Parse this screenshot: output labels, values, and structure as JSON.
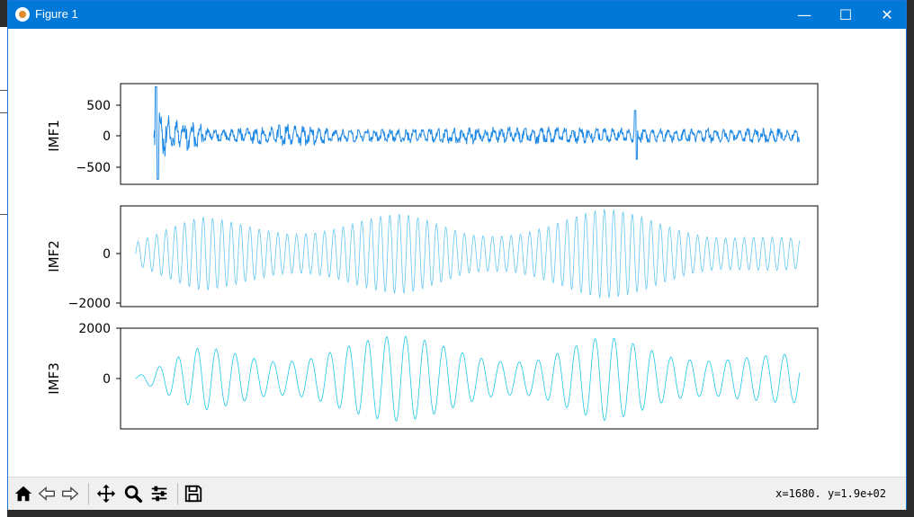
{
  "window": {
    "title": "Figure 1",
    "minimize_glyph": "—",
    "maximize_glyph": "☐",
    "close_glyph": "✕"
  },
  "toolbar": {
    "icons": [
      "home-icon",
      "back-icon",
      "forward-icon",
      "pan-icon",
      "zoom-icon",
      "configure-subplots-icon",
      "save-icon"
    ],
    "coords": "x=1680. y=1.9e+02"
  },
  "colors": {
    "titlebar": "#0078d7",
    "imf1": "#1e88e5",
    "imf2": "#64c8f0",
    "imf3": "#1ec8e6"
  },
  "chart_data": [
    {
      "type": "line",
      "ylabel": "IMF1",
      "yticks": [
        "500",
        "0",
        "−500"
      ],
      "ytick_values": [
        500,
        0,
        -500
      ],
      "ylim": [
        -780,
        830
      ],
      "xlim": [
        -5,
        225
      ],
      "x": [
        6,
        28,
        50,
        72,
        94,
        116,
        138,
        160,
        182,
        204,
        215
      ],
      "series": [
        {
          "values": [
            -680,
            60,
            250,
            80,
            120,
            160,
            150,
            110,
            100,
            130,
            100
          ]
        }
      ],
      "note_data": "envelope peaks: 780 at x≈7, 320 at x≈45, 300 at x≈130, 400 at x≈165"
    },
    {
      "type": "line",
      "ylabel": "IMF2",
      "yticks": [
        "0",
        "−2000"
      ],
      "ytick_values": [
        0,
        -2000
      ],
      "ylim": [
        -2100,
        1900
      ],
      "xlim": [
        -5,
        225
      ],
      "x": [
        0,
        22,
        44,
        66,
        88,
        110,
        132,
        154,
        176,
        198,
        220
      ],
      "series": [
        {
          "values": [
            600,
            -1500,
            1600,
            -1500,
            1600,
            -1200,
            1600,
            -1800,
            1500,
            -1200,
            -600
          ]
        }
      ]
    },
    {
      "type": "line",
      "ylabel": "IMF3",
      "yticks": [
        "2000",
        "0"
      ],
      "ytick_values": [
        2000,
        0
      ],
      "ylim": [
        -2000,
        2000
      ],
      "xlim": [
        -5,
        225
      ],
      "x": [
        0,
        22,
        44,
        66,
        88,
        110,
        132,
        154,
        176,
        198,
        220
      ],
      "series": [
        {
          "values": [
            -100,
            1300,
            -1200,
            1700,
            -1700,
            1500,
            -1200,
            1700,
            -1200,
            1500,
            1000
          ]
        }
      ]
    }
  ]
}
